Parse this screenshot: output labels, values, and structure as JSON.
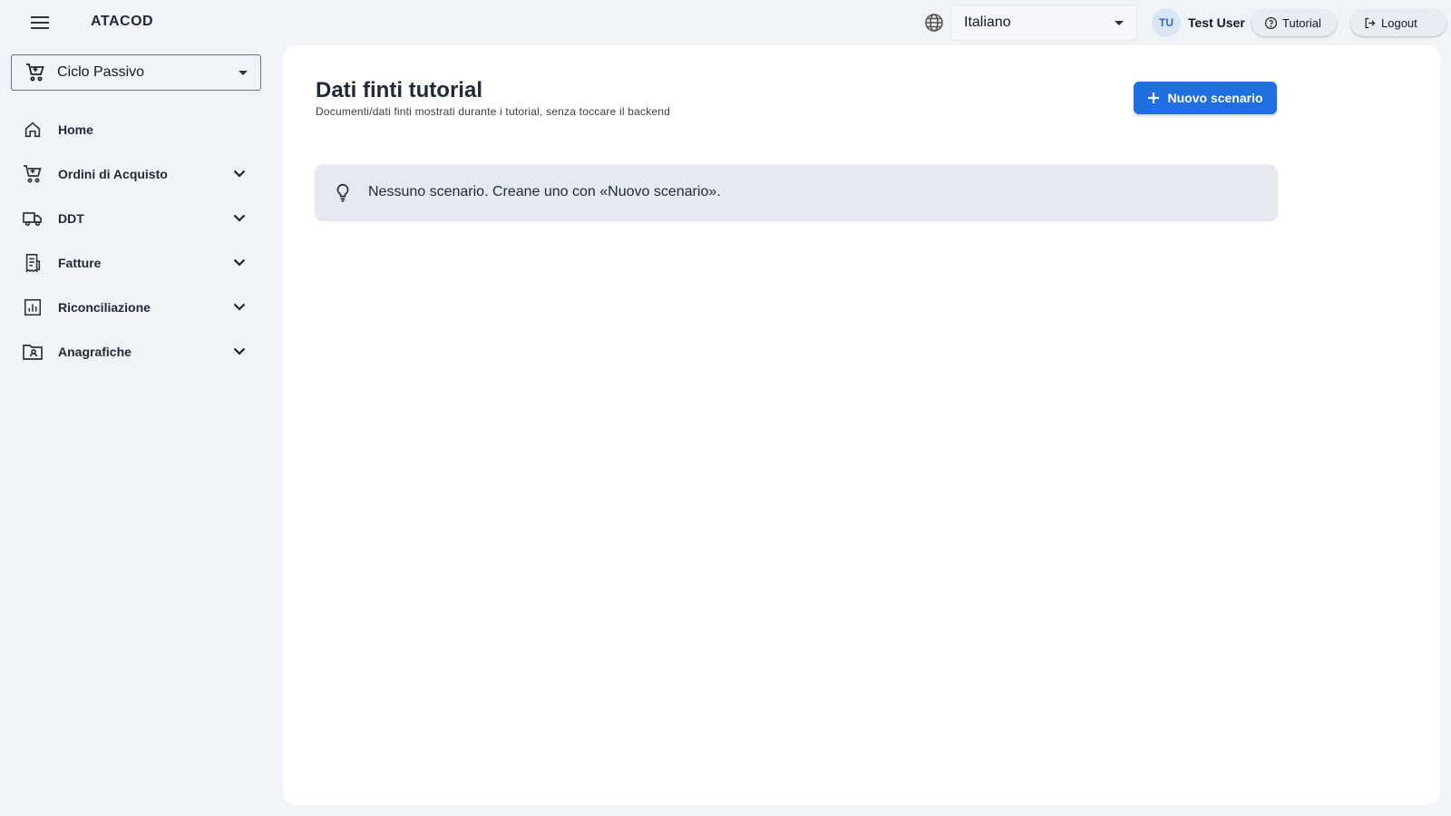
{
  "header": {
    "brand": "ATACOD",
    "menu_icon": "hamburger-menu-icon",
    "language_icon": "globe-icon",
    "language_value": "Italiano",
    "user_initials": "TU",
    "user_name": "Test User",
    "tutorial_label": "Tutorial",
    "tutorial_icon": "help-circle-icon",
    "logout_label": "Logout",
    "logout_icon": "logout-icon"
  },
  "sidebar": {
    "cycle_label": "Ciclo Passivo",
    "cycle_icon": "shopping-cart-icon",
    "items": [
      {
        "label": "Home",
        "icon": "home-icon",
        "expandable": false
      },
      {
        "label": "Ordini di Acquisto",
        "icon": "shopping-cart-icon",
        "expandable": true
      },
      {
        "label": "DDT",
        "icon": "truck-icon",
        "expandable": true
      },
      {
        "label": "Fatture",
        "icon": "receipt-icon",
        "expandable": true
      },
      {
        "label": "Riconciliazione",
        "icon": "bar-chart-icon",
        "expandable": true
      },
      {
        "label": "Anagrafiche",
        "icon": "contact-folder-icon",
        "expandable": true
      }
    ]
  },
  "main": {
    "title": "Dati finti tutorial",
    "subtitle": "Documenti/dati finti mostrati durante i tutorial, senza toccare il backend",
    "new_button_label": "Nuovo scenario",
    "new_button_icon": "plus-icon",
    "empty_message": "Nessuno scenario. Creane uno con «Nuovo scenario».",
    "empty_icon": "lightbulb-icon"
  },
  "colors": {
    "background": "#f0f3f7",
    "primary": "#1f6fe0",
    "panel": "#ffffff",
    "alert_bg": "#e5eaf2",
    "avatar_bg": "#dbe6f4"
  }
}
